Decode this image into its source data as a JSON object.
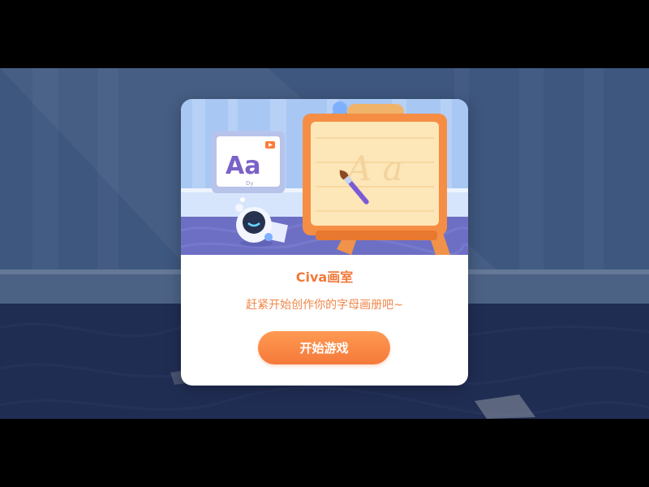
{
  "dialog": {
    "title": "Civa画室",
    "subtitle": "赶紧开始创作你的字母画册吧~",
    "start_button_label": "开始游戏"
  },
  "illustration": {
    "board_text": "Aa",
    "board_caption": "Dy",
    "easel_letters": "A a",
    "icons": [
      "play-icon",
      "paintbrush-icon",
      "robot-icon"
    ]
  },
  "colors": {
    "accent": "#f07a3a",
    "button": "#ff8a45",
    "card_background": "#ffffff",
    "scene_background": "#22335a"
  }
}
